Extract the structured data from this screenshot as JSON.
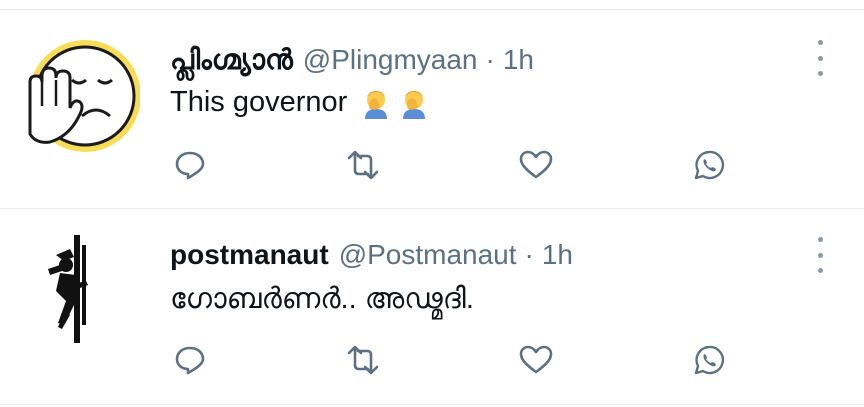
{
  "tweets": [
    {
      "name": "പ്ലിംഗ്മ്യാൻ",
      "handle": "@Plingmyaan",
      "separator": "·",
      "time": "1h",
      "text": "This governor",
      "emoji": "face-palm-emoji",
      "avatar": "sleepy-face-palm-avatar",
      "avatar_color": "#f7dd57"
    },
    {
      "name": "postmanaut",
      "handle": "@Postmanaut",
      "separator": "·",
      "time": "1h",
      "text": "ഗോബർണർ.. അഢ്മദി.",
      "avatar": "climber-silhouette-avatar"
    }
  ],
  "actions": [
    "reply-icon",
    "retweet-icon",
    "like-icon",
    "whatsapp-share-icon"
  ],
  "colors": {
    "icon": "#5b7083",
    "divider": "#e6ecf0",
    "handle": "#5b7083"
  }
}
